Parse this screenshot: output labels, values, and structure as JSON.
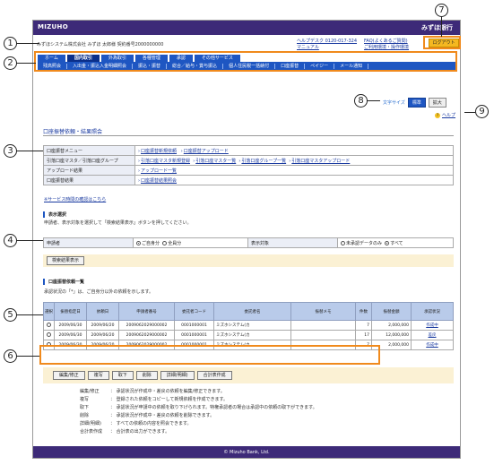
{
  "header": {
    "brand": "MIZUHO",
    "brand_right": "みずほ銀行",
    "user_line": "みずほシステム株式会社 みずほ 太郎様  契約番号2000000000",
    "links_left": [
      "ヘルプデスク 0120-017-324",
      "マニュアル"
    ],
    "links_right": [
      "FAQ(よくあるご質問)",
      "ご利用環境・操作環境"
    ],
    "logout_label": "ログアウト"
  },
  "nav": {
    "main": [
      "ホーム",
      "国内取引",
      "外為取引",
      "各種管理",
      "承認",
      "その他サービス"
    ],
    "active_index": 1,
    "sub": [
      "残高照会",
      "入出金・振込入金明細照会",
      "振込・振替",
      "総合／給与・賞与振込",
      "個人住民税一括納付",
      "口座振替",
      "ペイジー",
      "メール通知"
    ]
  },
  "text_size": {
    "label": "文字サイズ",
    "standard": "標準",
    "large": "拡大"
  },
  "help": {
    "icon": "?",
    "label": "ヘルプ"
  },
  "page_title": "口座振替依頼・結果照会",
  "menu_table": [
    {
      "head": "口座振替メニュー",
      "links": [
        "口座振替新規依頼",
        "口座振替アップロード"
      ]
    },
    {
      "head": "引落口座マスタ／引落口座グループ",
      "links": [
        "引落口座マスタ新規登録",
        "引落口座マスター覧",
        "引落口座グループ一覧",
        "引落口座マスタアップロード"
      ]
    },
    {
      "head": "アップロード結果",
      "links": [
        "アップロード一覧"
      ]
    },
    {
      "head": "口座振替結果",
      "links": [
        "口座振替結果照会"
      ]
    }
  ],
  "service_note": "※サービス時間の確認はこちら",
  "filter_section": {
    "title": "表示選択",
    "desc": "申請者、表示対象を選択して「検索結果表示」ボタンを押してください。",
    "applicant_label": "申請者",
    "applicant_options": [
      "ご自身分",
      "全員分"
    ],
    "target_label": "表示対象",
    "target_options": [
      "未承認データのみ",
      "すべて"
    ],
    "search_button": "検索結果表示"
  },
  "request_section": {
    "title": "口座振替依頼一覧",
    "desc": "承認状況の「*」は、ご自身分以外の依頼を示します。",
    "columns": [
      "選択",
      "振替指定日",
      "依頼日",
      "申請者番号",
      "委託者コード",
      "委託者名",
      "振替メモ",
      "件数",
      "振替金額",
      "承認状況"
    ],
    "rows": [
      [
        "",
        "2009/06/30",
        "2009/06/20",
        "2009062029000002",
        "0001000001",
        "ミズホシステム(カ",
        "",
        "7",
        "2,000,000",
        "作成中"
      ],
      [
        "",
        "2009/06/30",
        "2009/06/20",
        "2009062029000002",
        "0001000001",
        "ミズホシステム(カ",
        "",
        "17",
        "12,000,000",
        "差戻"
      ],
      [
        "",
        "2009/06/30",
        "2009/06/20",
        "2009062029000002",
        "0001000001",
        "ミズホシステム(カ",
        "",
        "7",
        "2,000,000",
        "作成中"
      ]
    ]
  },
  "actions": [
    "編集/修正",
    "複写",
    "取下",
    "削除",
    "詳細(明細)",
    "合計表作成"
  ],
  "legend": [
    [
      "編集/修正",
      "： 承認状況が作成中・差戻の依頼を編集/修正できます。"
    ],
    [
      "複写",
      "： 登録された依頼をコピーして新規依頼を作成できます。"
    ],
    [
      "取下",
      "： 承認状況が申請中の依頼を取り下げられます。特権承認者の場合は承認中の依頼の取下ができます。"
    ],
    [
      "削除",
      "： 承認状況が作成中・差戻の依頼を削除できます。"
    ],
    [
      "詳細(明細)",
      "： すべての依頼の内容を照会できます。"
    ],
    [
      "合計表作成",
      "： 合計表の出力ができます。"
    ]
  ],
  "footer": "© Mizuho Bank, Ltd.",
  "callouts": [
    "1",
    "2",
    "3",
    "4",
    "5",
    "6",
    "7",
    "8",
    "9"
  ]
}
